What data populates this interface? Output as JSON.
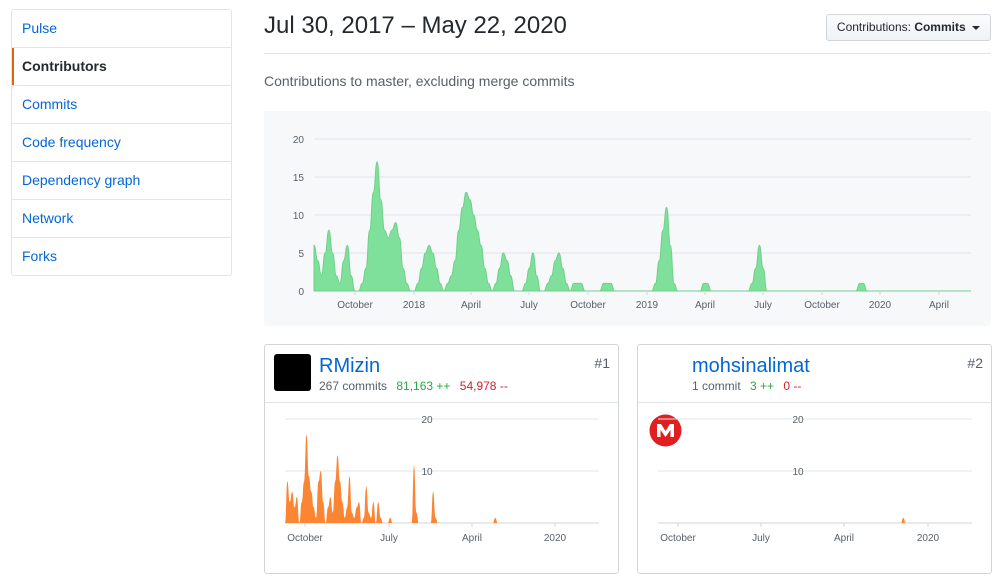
{
  "sidebar": {
    "items": [
      {
        "label": "Pulse",
        "selected": false
      },
      {
        "label": "Contributors",
        "selected": true
      },
      {
        "label": "Commits",
        "selected": false
      },
      {
        "label": "Code frequency",
        "selected": false
      },
      {
        "label": "Dependency graph",
        "selected": false
      },
      {
        "label": "Network",
        "selected": false
      },
      {
        "label": "Forks",
        "selected": false
      }
    ]
  },
  "header": {
    "title": "Jul 30, 2017 – May 22, 2020",
    "dropdown_prefix": "Contributions:",
    "dropdown_value": "Commits",
    "subtitle": "Contributions to master, excluding merge commits"
  },
  "colors": {
    "main_area": "#7ee09a",
    "main_stroke": "#6fcf8a",
    "user_area": "#fb8532",
    "link": "#0366d6",
    "additions": "#28a745",
    "deletions": "#cb2431",
    "accent": "#e36209"
  },
  "chart_data": [
    {
      "type": "area",
      "title": "",
      "y_ticks": [
        0,
        5,
        10,
        15,
        20
      ],
      "ylim": [
        0,
        20
      ],
      "x_tick_labels": [
        "October",
        "2018",
        "April",
        "July",
        "October",
        "2019",
        "April",
        "July",
        "October",
        "2020",
        "April"
      ],
      "series": [
        {
          "values": [
            6,
            4,
            2,
            5,
            8,
            5,
            2,
            1,
            4,
            6,
            2,
            0,
            0,
            1,
            3,
            8,
            13,
            17,
            12,
            8,
            7,
            8,
            9,
            7,
            3,
            1,
            0,
            0,
            1,
            3,
            5,
            6,
            5,
            3,
            1,
            0,
            1,
            2,
            4,
            8,
            11,
            13,
            12,
            10,
            8,
            6,
            3,
            1,
            0,
            1,
            3,
            5,
            4,
            2,
            0,
            0,
            0,
            1,
            3,
            5,
            2,
            0,
            0,
            1,
            2,
            4,
            5,
            3,
            1,
            0,
            1,
            1,
            1,
            0,
            0,
            0,
            0,
            0,
            1,
            1,
            1,
            0,
            0,
            0,
            0,
            0,
            0,
            0,
            0,
            0,
            0,
            0,
            1,
            4,
            8,
            11,
            6,
            1,
            0,
            0,
            0,
            0,
            0,
            0,
            0,
            1,
            1,
            0,
            0,
            0,
            0,
            0,
            0,
            0,
            0,
            0,
            0,
            0,
            1,
            3,
            6,
            3,
            0,
            0,
            0,
            0,
            0,
            0,
            0,
            0,
            0,
            0,
            0,
            0,
            0,
            0,
            0,
            0,
            0,
            0,
            0,
            0,
            0,
            0,
            0,
            0,
            0,
            1,
            1,
            0,
            0,
            0,
            0,
            0,
            0,
            0,
            0,
            0,
            0,
            0,
            0,
            0,
            0,
            0,
            0,
            0,
            0,
            0,
            0,
            0,
            0,
            0,
            0,
            0,
            0,
            0,
            0,
            0
          ]
        }
      ]
    },
    {
      "type": "area",
      "title": "",
      "y_ticks": [
        10,
        20
      ],
      "ylim": [
        0,
        20
      ],
      "x_tick_labels": [
        "October",
        "July",
        "April",
        "2020"
      ],
      "series": [
        {
          "values": [
            0,
            8,
            4,
            6,
            3,
            5,
            0,
            4,
            8,
            17,
            9,
            6,
            3,
            1,
            8,
            10,
            4,
            0,
            3,
            5,
            2,
            8,
            13,
            8,
            4,
            1,
            3,
            9,
            2,
            1,
            3,
            4,
            0,
            1,
            7,
            2,
            1,
            4,
            0,
            4,
            1,
            0,
            0,
            0,
            1,
            0,
            0,
            0,
            0,
            0,
            0,
            0,
            0,
            0,
            11,
            2,
            0,
            0,
            0,
            0,
            0,
            0,
            6,
            1,
            0,
            0,
            0,
            0,
            0,
            0,
            0,
            0,
            0,
            0,
            0,
            0,
            0,
            0,
            0,
            0,
            0,
            0,
            0,
            0,
            0,
            0,
            0,
            0,
            1,
            0,
            0,
            0,
            0,
            0,
            0,
            0,
            0,
            0,
            0,
            0,
            0,
            0,
            0,
            0,
            0,
            0,
            0,
            0,
            0,
            0,
            0,
            0,
            0,
            0
          ]
        }
      ]
    },
    {
      "type": "area",
      "title": "",
      "y_ticks": [
        10,
        20
      ],
      "ylim": [
        0,
        20
      ],
      "x_tick_labels": [
        "October",
        "July",
        "April",
        "2020"
      ],
      "series": [
        {
          "values": [
            0,
            0,
            0,
            0,
            0,
            0,
            0,
            0,
            0,
            0,
            0,
            0,
            0,
            0,
            0,
            0,
            0,
            0,
            0,
            0,
            0,
            0,
            0,
            0,
            0,
            0,
            0,
            0,
            0,
            0,
            0,
            0,
            0,
            0,
            0,
            0,
            0,
            0,
            0,
            0,
            0,
            0,
            0,
            0,
            0,
            0,
            0,
            0,
            0,
            0,
            0,
            0,
            0,
            0,
            0,
            0,
            0,
            0,
            0,
            0,
            0,
            0,
            0,
            0,
            0,
            0,
            0,
            0,
            0,
            0,
            0,
            0,
            0,
            0,
            0,
            0,
            0,
            0,
            0,
            0,
            0,
            0,
            0,
            0,
            0,
            0,
            0,
            0,
            0,
            0,
            0,
            0,
            0,
            0,
            0,
            0,
            0,
            0,
            0,
            0,
            0,
            0,
            0,
            0,
            0,
            0,
            1,
            0,
            0,
            0,
            0,
            0,
            0,
            0,
            0,
            0,
            0,
            0,
            0,
            0,
            0,
            0
          ]
        }
      ]
    }
  ],
  "contributors": [
    {
      "rank": "#1",
      "name": "RMizin",
      "commits": "267 commits",
      "additions": "81,163 ++",
      "deletions": "54,978 --",
      "avatar_color": "#000000"
    },
    {
      "rank": "#2",
      "name": "mohsinalimat",
      "commits": "1 commit",
      "additions": "3 ++",
      "deletions": "0 --",
      "avatar_color": "#e02020"
    }
  ]
}
